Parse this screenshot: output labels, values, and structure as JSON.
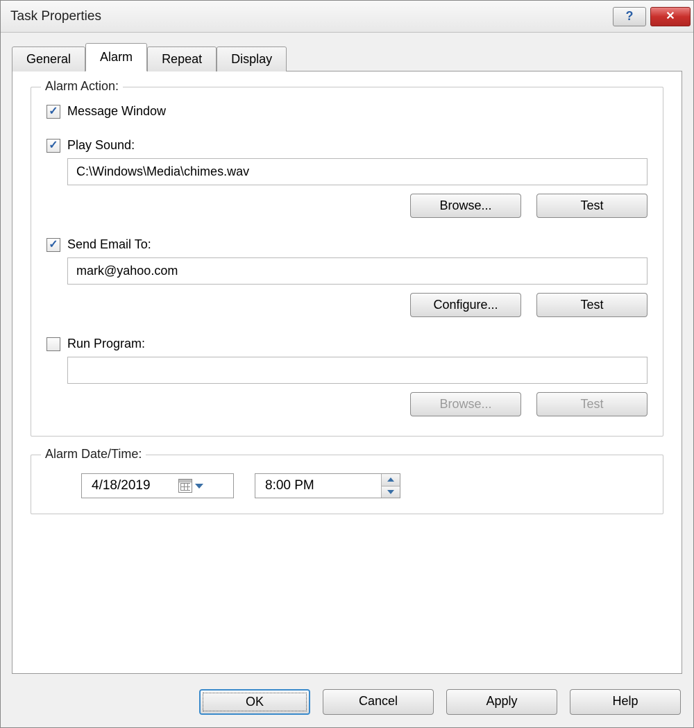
{
  "window": {
    "title": "Task Properties"
  },
  "tabs": {
    "items": [
      {
        "label": "General"
      },
      {
        "label": "Alarm"
      },
      {
        "label": "Repeat"
      },
      {
        "label": "Display"
      }
    ],
    "active_index": 1
  },
  "alarm_action": {
    "legend": "Alarm Action:",
    "message_window": {
      "label": "Message Window",
      "checked": true
    },
    "play_sound": {
      "label": "Play Sound:",
      "checked": true,
      "path": "C:\\Windows\\Media\\chimes.wav",
      "browse_label": "Browse...",
      "test_label": "Test"
    },
    "send_email": {
      "label": "Send Email To:",
      "checked": true,
      "address": "mark@yahoo.com",
      "configure_label": "Configure...",
      "test_label": "Test"
    },
    "run_program": {
      "label": "Run Program:",
      "checked": false,
      "path": "",
      "browse_label": "Browse...",
      "test_label": "Test"
    }
  },
  "alarm_datetime": {
    "legend": "Alarm Date/Time:",
    "date": "4/18/2019",
    "time": "8:00 PM"
  },
  "dialog_buttons": {
    "ok": "OK",
    "cancel": "Cancel",
    "apply": "Apply",
    "help": "Help"
  }
}
